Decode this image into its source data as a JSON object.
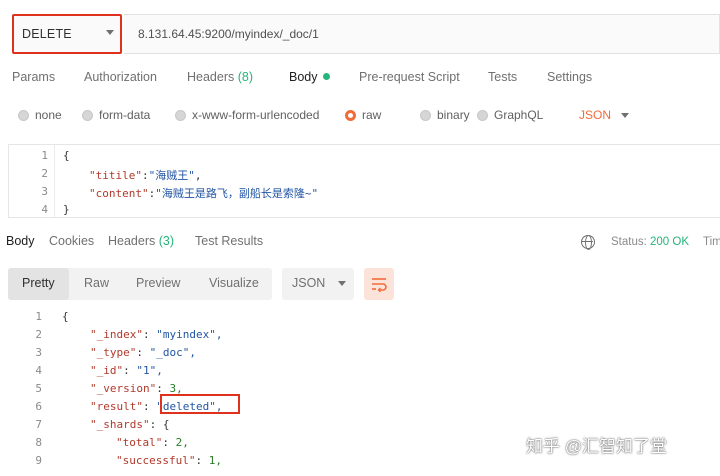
{
  "request": {
    "method": "DELETE",
    "url": "8.131.64.45:9200/myindex/_doc/1"
  },
  "request_tabs": [
    {
      "label": "Params"
    },
    {
      "label": "Authorization"
    },
    {
      "label": "Headers",
      "count": "(8)"
    },
    {
      "label": "Body",
      "active": true
    },
    {
      "label": "Pre-request Script"
    },
    {
      "label": "Tests"
    },
    {
      "label": "Settings"
    }
  ],
  "body_types": [
    {
      "label": "none",
      "selected": false
    },
    {
      "label": "form-data",
      "selected": false
    },
    {
      "label": "x-www-form-urlencoded",
      "selected": false
    },
    {
      "label": "raw",
      "selected": true
    },
    {
      "label": "binary",
      "selected": false
    },
    {
      "label": "GraphQL",
      "selected": false
    }
  ],
  "body_language": "JSON",
  "request_body": {
    "line_numbers": [
      "1",
      "2",
      "3",
      "4"
    ],
    "open_brace": "{",
    "close_brace": "}",
    "line2_key": "\"titile\"",
    "line2_value": "\"海贼王\"",
    "line3_key": "\"content\"",
    "line3_value": "\"海贼王是路飞，副船长是索隆~\""
  },
  "response_tabs": [
    {
      "label": "Body",
      "active": true
    },
    {
      "label": "Cookies"
    },
    {
      "label": "Headers",
      "count": "(3)"
    },
    {
      "label": "Test Results"
    }
  ],
  "response_status": {
    "label": "Status:",
    "value": "200 OK",
    "time_label": "Time"
  },
  "response_views": [
    {
      "label": "Pretty",
      "active": true
    },
    {
      "label": "Raw"
    },
    {
      "label": "Preview"
    },
    {
      "label": "Visualize"
    }
  ],
  "response_format": "JSON",
  "response_body": {
    "line_numbers": [
      "1",
      "2",
      "3",
      "4",
      "5",
      "6",
      "7",
      "8",
      "9"
    ],
    "lines": [
      {
        "key": "\"_index\"",
        "value": "\"myindex\","
      },
      {
        "key": "\"_type\"",
        "value": "\"_doc\","
      },
      {
        "key": "\"_id\"",
        "value": "\"1\","
      },
      {
        "key": "\"_version\"",
        "value": "3,"
      },
      {
        "key": "\"result\"",
        "value": "\"deleted\","
      },
      {
        "key": "\"_shards\"",
        "value": "{"
      },
      {
        "key": "\"total\"",
        "value": "2,"
      },
      {
        "key": "\"successful\"",
        "value": "1,"
      }
    ],
    "open_brace": "{"
  },
  "colors": {
    "accent": "#f26b3a",
    "highlight_box": "#e0301e",
    "status_ok": "#26b47a",
    "json_key": "#b0392b",
    "json_string": "#2255a4"
  },
  "watermark": "知乎 @汇智知了堂"
}
